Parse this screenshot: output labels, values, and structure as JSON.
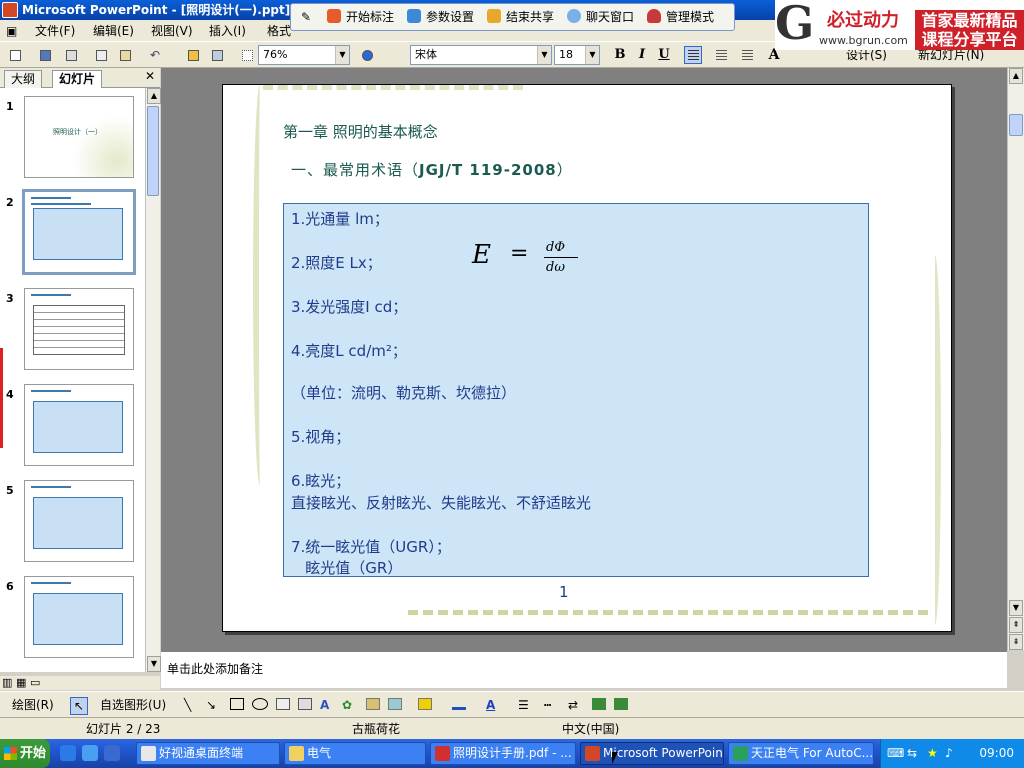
{
  "window": {
    "title": "Microsoft PowerPoint - [照明设计(一).ppt]"
  },
  "menu": {
    "items": [
      "文件(F)",
      "编辑(E)",
      "视图(V)",
      "插入(I)",
      "格式"
    ]
  },
  "floating_toolbar": {
    "items": [
      "开始标注",
      "参数设置",
      "结束共享",
      "聊天窗口",
      "管理模式"
    ]
  },
  "watermark": {
    "brand": "必过动力",
    "url": "www.bgrun.com",
    "promo_line1": "首家最新精品",
    "promo_line2": "课程分享平台"
  },
  "toolbar": {
    "zoom": "76%",
    "font": "宋体",
    "size": "18",
    "bold": "B",
    "italic": "I",
    "underline": "U",
    "right_items": [
      "设计(S)",
      "新幻灯片(N)"
    ]
  },
  "left_pane": {
    "tabs": [
      "大纲",
      "幻灯片"
    ],
    "slide_numbers": [
      "1",
      "2",
      "3",
      "4",
      "5",
      "6"
    ],
    "slide1_title": "照明设计（一）"
  },
  "slide": {
    "chapter": "第一章 照明的基本概念",
    "section_prefix": "一、最常用术语（",
    "section_code": "JGJ/T 119-2008",
    "section_suffix": "）",
    "items": [
      "1.光通量     lm；",
      "2.照度E    Lx；",
      "3.发光强度I    cd；",
      "4.亮度L     cd/m²；",
      "（单位：流明、勒克斯、坎德拉）",
      "5.视角；",
      "6.眩光；",
      "直接眩光、反射眩光、失能眩光、不舒适眩光",
      "7.统一眩光值（UGR）；",
      "   眩光值（GR）"
    ],
    "formula_lhs": "E",
    "formula_eq": "=",
    "formula_num": "dΦ",
    "formula_den": "dω",
    "page_number": "1"
  },
  "notes": {
    "placeholder": "单击此处添加备注"
  },
  "draw_toolbar": {
    "draw": "绘图(R)",
    "autoshapes": "自选图形(U)"
  },
  "status": {
    "slide": "幻灯片 2 / 23",
    "design": "古瓶荷花",
    "language": "中文(中国)"
  },
  "taskbar": {
    "start": "开始",
    "tasks": [
      "好视通桌面终端",
      "电气",
      "照明设计手册.pdf - ...",
      "Microsoft PowerPoint ...",
      "天正电气 For AutoC..."
    ],
    "clock": "09:00"
  }
}
